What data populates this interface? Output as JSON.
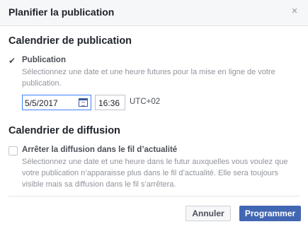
{
  "dialog": {
    "title": "Planifier la publication",
    "close_glyph": "×"
  },
  "publication_schedule": {
    "title": "Calendrier de publication",
    "option": {
      "checked": true,
      "label": "Publication",
      "description_line1": "Sélectionnez une date et une heure futures pour la mise en ligne de votre",
      "description_line2": "publication."
    },
    "date_value": "5/5/2017",
    "time_value": "16:36",
    "timezone": "UTC+02"
  },
  "distribution_schedule": {
    "title": "Calendrier de diffusion",
    "option": {
      "checked": false,
      "label": "Arrêter la diffusion dans le fil d’actualité",
      "description_line1": "Sélectionnez une date et une heure dans le futur auxquelles vous voulez que",
      "description_line2": "votre publication n’apparaisse plus dans le fil d’actualité. Elle sera toujours",
      "description_line3": "visible mais sa diffusion dans le fil s’arrêtera."
    }
  },
  "footer": {
    "cancel_label": "Annuler",
    "submit_label": "Programmer"
  },
  "colors": {
    "primary": "#4267b2",
    "focus_border": "#4080ff",
    "header_bg": "#f6f7f9"
  },
  "icons": {
    "close": "close-icon",
    "checkbox_checked": "checkmark-icon",
    "calendar": "calendar-icon"
  }
}
